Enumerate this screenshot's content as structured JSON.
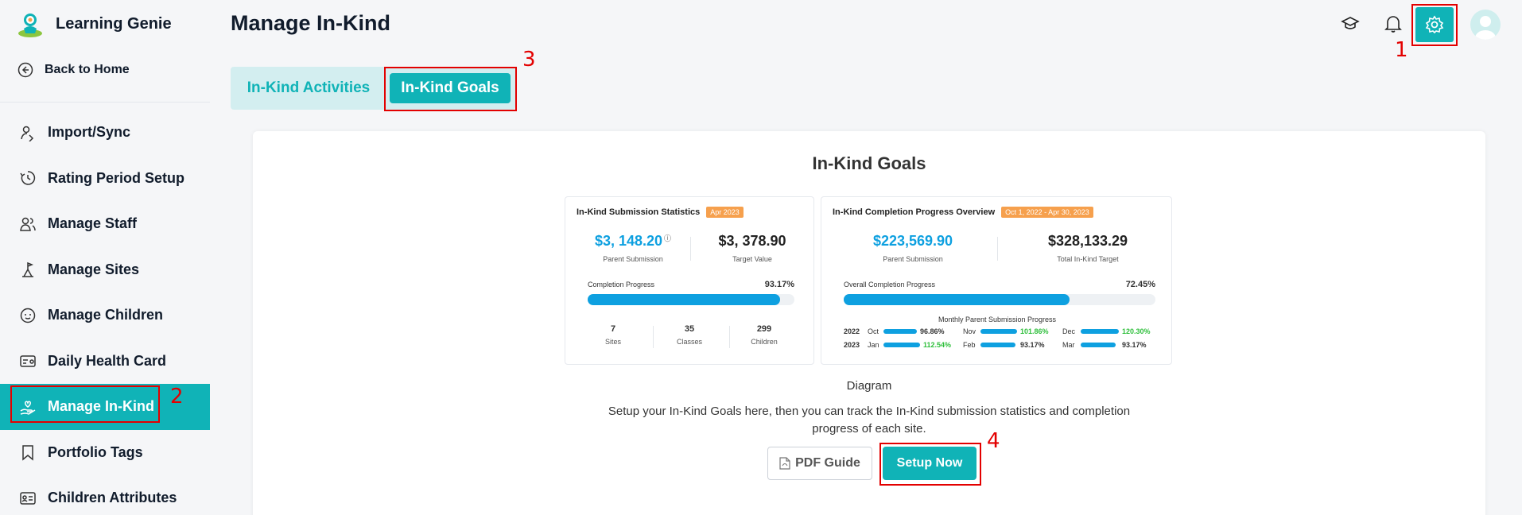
{
  "app": {
    "title": "Learning Genie",
    "back_label": "Back to Home"
  },
  "sidebar": {
    "items": [
      {
        "label": "Import/Sync",
        "icon": "import-sync-icon"
      },
      {
        "label": "Rating Period Setup",
        "icon": "rating-period-icon"
      },
      {
        "label": "Manage Staff",
        "icon": "staff-icon"
      },
      {
        "label": "Manage Sites",
        "icon": "sites-icon"
      },
      {
        "label": "Manage Children",
        "icon": "children-icon"
      },
      {
        "label": "Daily Health Card",
        "icon": "health-card-icon"
      },
      {
        "label": "Manage In-Kind",
        "icon": "in-kind-icon",
        "active": true
      },
      {
        "label": "Portfolio Tags",
        "icon": "bookmark-icon"
      },
      {
        "label": "Children Attributes",
        "icon": "attributes-icon"
      }
    ]
  },
  "header": {
    "title": "Manage In-Kind"
  },
  "tabs": [
    {
      "label": "In-Kind Activities"
    },
    {
      "label": "In-Kind Goals",
      "active": true
    }
  ],
  "card": {
    "title": "In-Kind Goals",
    "diagram_caption": "Diagram",
    "description_line1": "Setup your In-Kind Goals here, then you can track the In-Kind submission statistics and completion",
    "description_line2": "progress of each site.",
    "pdf_button": "PDF Guide",
    "setup_button": "Setup Now"
  },
  "left_panel": {
    "title": "In-Kind Submission Statistics",
    "tag": "Apr 2023",
    "parent_value": "$3, 148.20",
    "parent_label": "Parent Submission",
    "target_value": "$3, 378.90",
    "target_label": "Target Value",
    "progress_label": "Completion Progress",
    "progress_pct": "93.17%",
    "progress_fraction": 0.9317,
    "stats": [
      {
        "num": "7",
        "label": "Sites"
      },
      {
        "num": "35",
        "label": "Classes"
      },
      {
        "num": "299",
        "label": "Children"
      }
    ]
  },
  "right_panel": {
    "title": "In-Kind Completion Progress Overview",
    "tag": "Oct 1, 2022 - Apr 30, 2023",
    "parent_value": "$223,569.90",
    "parent_label": "Parent Submission",
    "target_value": "$328,133.29",
    "target_label": "Total In-Kind Target",
    "progress_label": "Overall Completion Progress",
    "progress_pct": "72.45%",
    "progress_fraction": 0.7245,
    "monthly_title": "Monthly Parent Submission Progress",
    "years": [
      "2022",
      "2023"
    ],
    "months": [
      {
        "m": "Oct",
        "pct": "96.86%",
        "over": false
      },
      {
        "m": "Nov",
        "pct": "101.86%",
        "over": true
      },
      {
        "m": "Dec",
        "pct": "120.30%",
        "over": true
      },
      {
        "m": "Jan",
        "pct": "112.54%",
        "over": true
      },
      {
        "m": "Feb",
        "pct": "93.17%",
        "over": false
      },
      {
        "m": "Mar",
        "pct": "93.17%",
        "over": false
      }
    ]
  },
  "annotations": [
    "1",
    "2",
    "3",
    "4"
  ],
  "colors": {
    "accent": "#10b3b7",
    "annotation": "#e30000",
    "progress": "#0ea0e0",
    "tag": "#f6a04d"
  }
}
